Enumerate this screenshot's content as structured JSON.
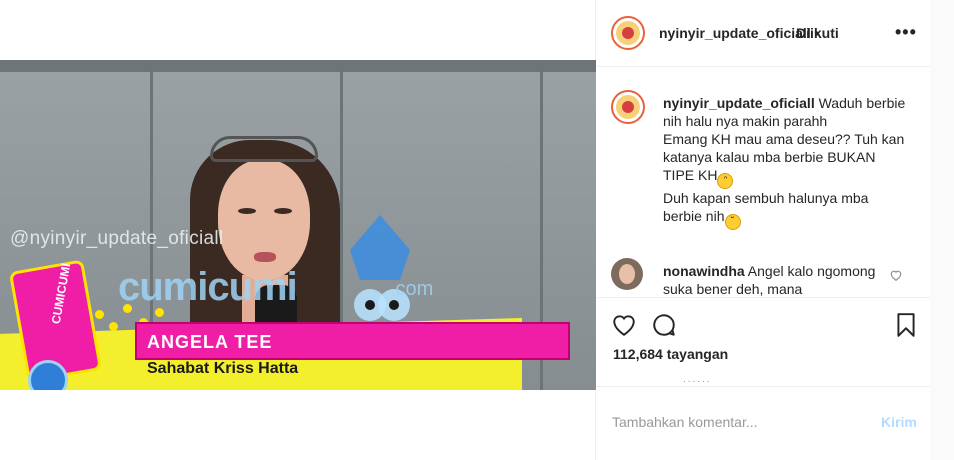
{
  "post": {
    "username": "nyinyir_update_oficiall",
    "separator": "•",
    "follow_status": "Diikuti",
    "more_label": "•••"
  },
  "video": {
    "watermark": "@nyinyir_update_oficiall",
    "brand_text": "cumicumi",
    "brand_suffix": ".com",
    "badge_text": "CUMICUMI",
    "name_lower_third": "ANGELA TEE",
    "role_lower_third": "Sahabat Kriss Hatta"
  },
  "caption": {
    "username": "nyinyir_update_oficiall",
    "line1": "Waduh berbie nih halu nya makin parahh",
    "line2": "Emang KH mau ama deseu?? Tuh kan katanya kalau mba berbie BUKAN TIPE KH",
    "emoji1": "grinning-sweat-emoji",
    "line3": "Duh kapan sembuh halunya mba berbie nih",
    "emoji2": "pensive-emoji"
  },
  "comment": {
    "username": "nonawindha",
    "text": "Angel kalo ngomong suka bener deh, mana"
  },
  "actions": {
    "views": "112,684 tayangan",
    "more_dots": "......"
  },
  "add_comment": {
    "placeholder": "Tambahkan komentar...",
    "send_label": "Kirim"
  },
  "colors": {
    "accent_link_disabled": "#b3dbff",
    "text": "#262626",
    "border": "#efefef",
    "lower_third_pink": "#f01da7",
    "lower_third_yellow": "#f3ef2c"
  }
}
